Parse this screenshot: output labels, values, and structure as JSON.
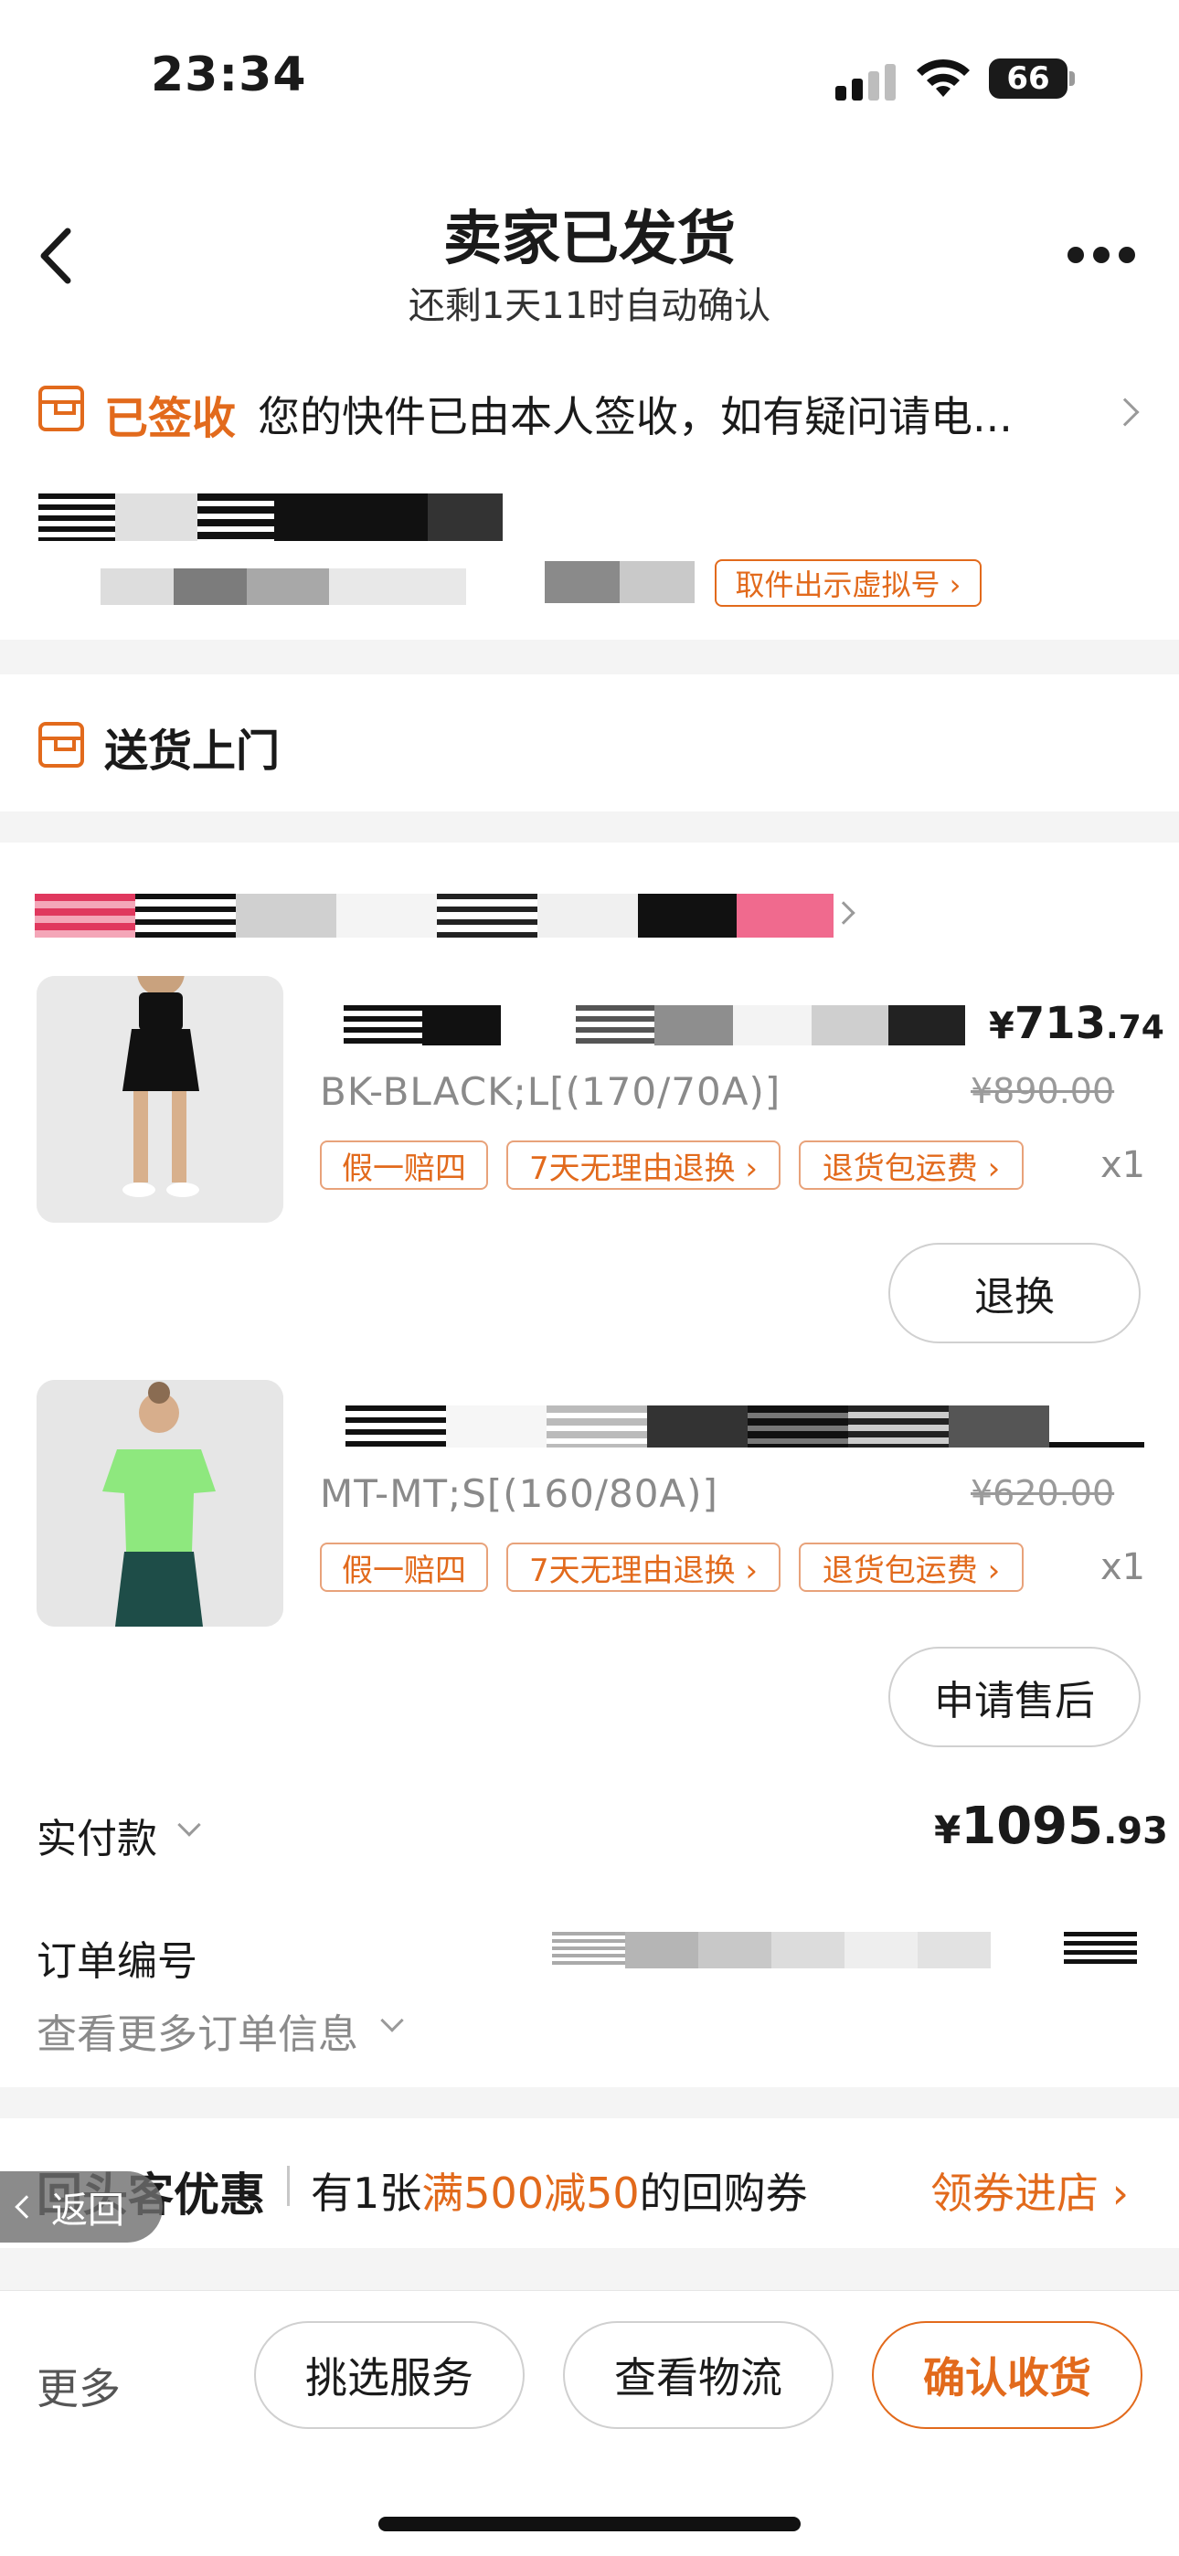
{
  "status_bar": {
    "time": "23:34",
    "battery": "66"
  },
  "header": {
    "title": "卖家已发货",
    "subtitle": "还剩1天11时自动确认"
  },
  "logistics": {
    "status": "已签收",
    "message": "您的快件已由本人签收，如有疑问请电...",
    "pickup_button": "取件出示虚拟号 ›"
  },
  "delivery": {
    "label": "送货上门"
  },
  "products": [
    {
      "price_yen": "¥",
      "price_int": "713",
      "price_dec": ".74",
      "sku": "BK-BLACK;L[(170/70A)]",
      "original_price": "¥890.00",
      "tags": [
        "假一赔四",
        "7天无理由退换 ›",
        "退货包运费 ›"
      ],
      "qty": "x1",
      "action": "退换"
    },
    {
      "sku": "MT-MT;S[(160/80A)]",
      "original_price": "¥620.00",
      "tags": [
        "假一赔四",
        "7天无理由退换 ›",
        "退货包运费 ›"
      ],
      "qty": "x1",
      "action": "申请售后"
    }
  ],
  "payment": {
    "label": "实付款",
    "yen": "¥",
    "int": "1095",
    "dec": ".93"
  },
  "order": {
    "number_label": "订单编号",
    "more_info": "查看更多订单信息"
  },
  "promo": {
    "title": "回头客优惠",
    "text_prefix": "有1张",
    "text_highlight": "满500减50",
    "text_suffix": "的回购券",
    "action": "领券进店 ›"
  },
  "floating": {
    "return_label": "返回"
  },
  "bottom_bar": {
    "more": "更多",
    "buttons": [
      "挑选服务",
      "查看物流",
      "确认收货"
    ]
  },
  "colors": {
    "accent": "#e26a1c",
    "background": "#f4f4f4"
  },
  "icons": [
    "back-icon",
    "more-icon",
    "box-icon",
    "chevron-right-icon",
    "chevron-down-icon",
    "wifi-icon",
    "signal-icon",
    "battery-icon"
  ]
}
